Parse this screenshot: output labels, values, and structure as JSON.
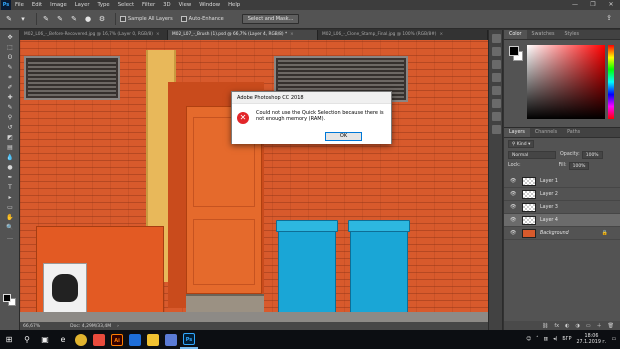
{
  "menubar": {
    "logo": "Ps",
    "items": [
      "File",
      "Edit",
      "Image",
      "Layer",
      "Type",
      "Select",
      "Filter",
      "3D",
      "View",
      "Window",
      "Help"
    ],
    "window_controls": [
      "—",
      "❐",
      "✕"
    ]
  },
  "options": {
    "sample_all_layers": "Sample All Layers",
    "auto_enhance": "Auto-Enhance",
    "select_mask_button": "Select and Mask..."
  },
  "tabs": [
    {
      "label": "M02_L06_-_Before-Recovered.jpg @ 16,7% (Layer 0, RGB/8)",
      "active": false
    },
    {
      "label": "M02_L07_-_Brush (1).psd @ 66,7% (Layer 4, RGB/8) *",
      "active": true
    },
    {
      "label": "M02_L06_-_Clone_Stamp_Final.jpg @ 100% (RGB/8#)",
      "active": false
    }
  ],
  "toolbar": {
    "tools": [
      "move-tool",
      "marquee-tool",
      "lasso-tool",
      "quick-selection-tool",
      "crop-tool",
      "eyedropper-tool",
      "healing-brush-tool",
      "brush-tool",
      "clone-stamp-tool",
      "history-brush-tool",
      "eraser-tool",
      "gradient-tool",
      "blur-tool",
      "dodge-tool",
      "pen-tool",
      "type-tool",
      "path-selection-tool",
      "rectangle-tool",
      "hand-tool",
      "zoom-tool",
      "more-tools"
    ],
    "glyphs": [
      "✥",
      "⬚",
      "ʘ",
      "✎",
      "⌗",
      "✐",
      "✚",
      "✎",
      "⚲",
      "↺",
      "◩",
      "▤",
      "💧",
      "●",
      "✒",
      "T",
      "▸",
      "▭",
      "✋",
      "🔍",
      "…"
    ]
  },
  "dialog": {
    "title": "Adobe Photoshop CC 2018",
    "icon": "error-icon",
    "message": "Could not use the Quick Selection because there is not enough memory (RAM).",
    "ok_label": "OK"
  },
  "statusbar": {
    "zoom": "66,67%",
    "doc_info": "Doc: 4,29M/33,4M",
    "arrow": "›"
  },
  "color_panel": {
    "tabs": [
      "Color",
      "Swatches",
      "Styles"
    ],
    "foreground": "#000000",
    "background": "#ffffff"
  },
  "layers_panel": {
    "tabs": [
      "Layers",
      "Channels",
      "Paths"
    ],
    "kind_label": "Kind",
    "blend_mode": "Normal",
    "opacity_label": "Opacity:",
    "opacity_value": "100%",
    "lock_label": "Lock:",
    "fill_label": "Fill:",
    "fill_value": "100%",
    "layers": [
      {
        "name": "Layer 1",
        "selected": false,
        "background": false
      },
      {
        "name": "Layer 2",
        "selected": false,
        "background": false
      },
      {
        "name": "Layer 3",
        "selected": false,
        "background": false
      },
      {
        "name": "Layer 4",
        "selected": true,
        "background": false
      },
      {
        "name": "Background",
        "selected": false,
        "background": true
      }
    ],
    "footer_icons": [
      "link-icon",
      "fx-icon",
      "mask-icon",
      "adjustment-icon",
      "group-icon",
      "new-layer-icon",
      "trash-icon"
    ],
    "footer_glyphs": [
      "⛓",
      "fx",
      "◐",
      "◑",
      "▭",
      "＋",
      "🗑"
    ]
  },
  "taskbar": {
    "apps": [
      {
        "name": "chrome",
        "label": "",
        "color": "#e0b32e"
      },
      {
        "name": "photos",
        "label": "",
        "color": "#e94b3c"
      },
      {
        "name": "illustrator",
        "label": "Ai",
        "color": "#ff7c00"
      },
      {
        "name": "mail",
        "label": "",
        "color": "#1e6ed9"
      },
      {
        "name": "explorer",
        "label": "",
        "color": "#f1c232"
      },
      {
        "name": "store",
        "label": "",
        "color": "#5b7bd5"
      },
      {
        "name": "photoshop",
        "label": "Ps",
        "color": "#31a8ff"
      }
    ],
    "language": "БГР",
    "time": "18:06",
    "date": "27.1.2019 г."
  }
}
